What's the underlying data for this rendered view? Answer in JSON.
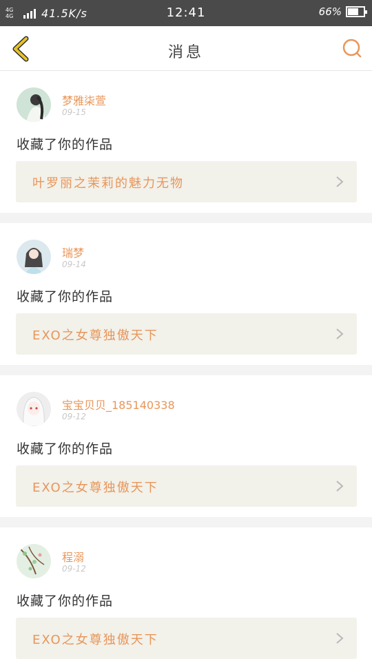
{
  "status_bar": {
    "network": "4G 4G",
    "speed": "41.5K/s",
    "time": "12:41",
    "battery": "66%",
    "battery_level": 0.66
  },
  "header": {
    "title": "消息",
    "back_icon": "chevron-left-icon",
    "search_icon": "search-icon"
  },
  "colors": {
    "accent": "#e8965a",
    "back_icon": "#e6c22e",
    "card_link_bg": "#f2f1ea"
  },
  "messages": [
    {
      "user": "梦雅柒萱",
      "date": "09-15",
      "action": "收藏了你的作品",
      "work": "叶罗丽之茉莉的魅力无物"
    },
    {
      "user": "瑞梦",
      "date": "09-14",
      "action": "收藏了你的作品",
      "work": "EXO之女尊独傲天下"
    },
    {
      "user": "宝宝贝贝_185140338",
      "date": "09-12",
      "action": "收藏了你的作品",
      "work": "EXO之女尊独傲天下"
    },
    {
      "user": "程溺",
      "date": "09-12",
      "action": "收藏了你的作品",
      "work": "EXO之女尊独傲天下"
    }
  ]
}
